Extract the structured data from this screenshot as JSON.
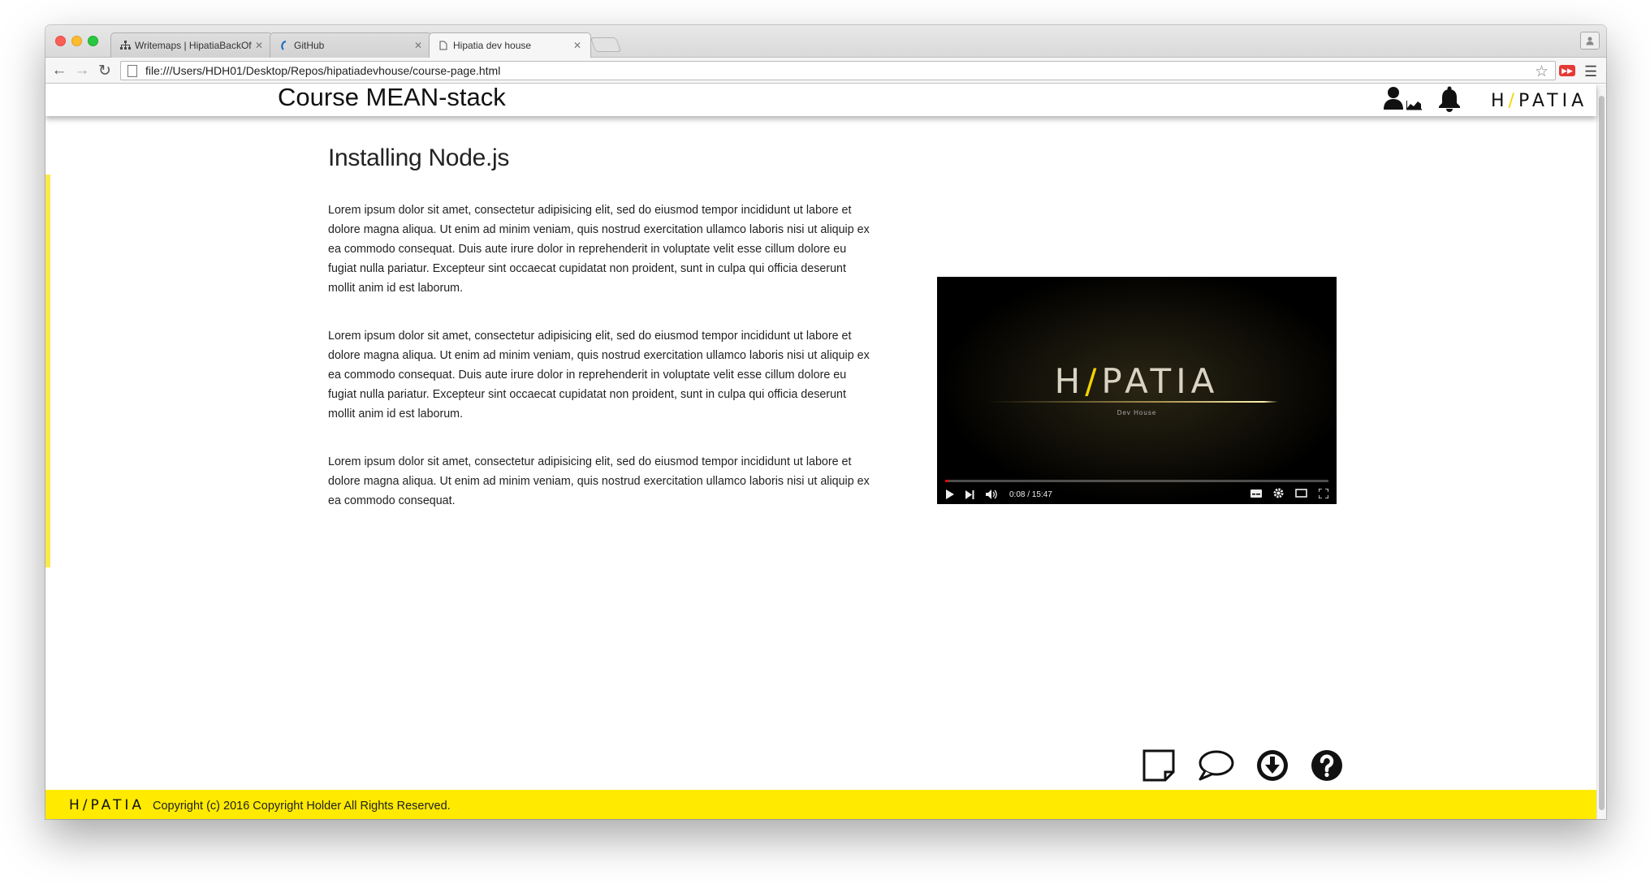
{
  "browser": {
    "tabs": [
      {
        "title": "Writemaps | HipatiaBackOf",
        "icon": "sitemap-icon",
        "active": false
      },
      {
        "title": "GitHub",
        "icon": "github-icon",
        "active": false
      },
      {
        "title": "Hipatia dev house",
        "icon": "page-icon",
        "active": true
      }
    ],
    "url": "file:///Users/HDH01/Desktop/Repos/hipatiadevhouse/course-page.html"
  },
  "header": {
    "course_title": "Course MEAN-stack",
    "logo": {
      "left": "H",
      "slash": "/",
      "right": "PATIA"
    },
    "icons": [
      "user-stats-icon",
      "bell-icon"
    ]
  },
  "lesson": {
    "title": "Installing Node.js",
    "paragraphs": [
      "Lorem ipsum dolor sit amet, consectetur adipisicing elit, sed do eiusmod tempor incididunt ut labore et dolore magna aliqua. Ut enim ad minim veniam, quis nostrud exercitation ullamco laboris nisi ut aliquip ex ea commodo consequat. Duis aute irure dolor in reprehenderit in voluptate velit esse cillum dolore eu fugiat nulla pariatur. Excepteur sint occaecat cupidatat non proident, sunt in culpa qui officia deserunt mollit anim id est laborum.",
      "Lorem ipsum dolor sit amet, consectetur adipisicing elit, sed do eiusmod tempor incididunt ut labore et dolore magna aliqua. Ut enim ad minim veniam, quis nostrud exercitation ullamco laboris nisi ut aliquip ex ea commodo consequat. Duis aute irure dolor in reprehenderit in voluptate velit esse cillum dolore eu fugiat nulla pariatur. Excepteur sint occaecat cupidatat non proident, sunt in culpa qui officia deserunt mollit anim id est laborum.",
      "Lorem ipsum dolor sit amet, consectetur adipisicing elit, sed do eiusmod tempor incididunt ut labore et dolore magna aliqua. Ut enim ad minim veniam, quis nostrud exercitation ullamco laboris nisi ut aliquip ex ea commodo consequat."
    ]
  },
  "video": {
    "logo": {
      "left": "H",
      "slash": "/",
      "right": "PATIA"
    },
    "subtitle": "Dev House",
    "time": "0:08 / 15:47",
    "progress": 0.008
  },
  "actions": [
    "note-icon",
    "comment-icon",
    "download-icon",
    "help-icon"
  ],
  "footer": {
    "logo": "H/PATIA",
    "copyright": "Copyright (c) 2016 Copyright Holder All Rights Reserved."
  },
  "colors": {
    "accent": "#ffea00",
    "sidebar": "#fde94a"
  }
}
